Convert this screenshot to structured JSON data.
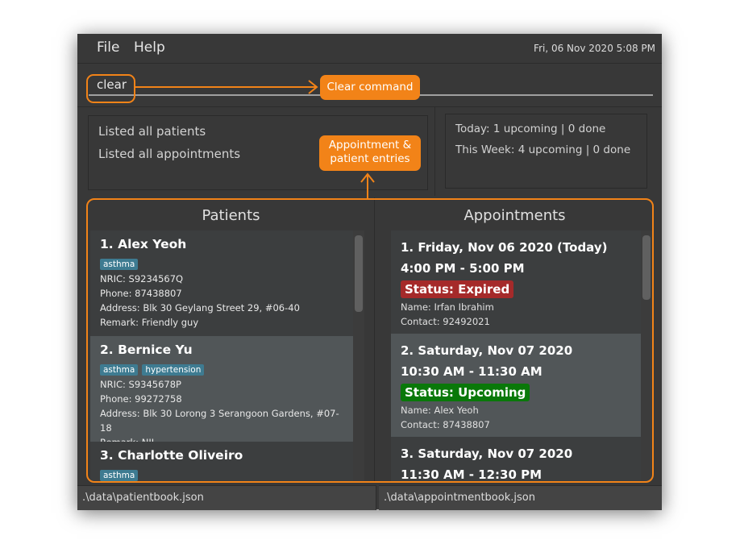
{
  "menu": {
    "items": [
      "File",
      "Help"
    ]
  },
  "clock": "Fri, 06 Nov 2020 5:08 PM",
  "command": {
    "value": "clear",
    "placeholder": ""
  },
  "result_display": {
    "lines": [
      "Listed all patients",
      "Listed all appointments"
    ]
  },
  "stats": {
    "today": "Today: 1 upcoming | 0 done",
    "week": "This Week: 4 upcoming | 0 done"
  },
  "patients_panel": {
    "title": "Patients",
    "items": [
      {
        "title": "1.  Alex Yeoh",
        "tags": [
          "asthma"
        ],
        "nric": "NRIC: S9234567Q",
        "phone": "Phone: 87438807",
        "address": "Address: Blk 30 Geylang Street 29, #06-40",
        "remark": "Remark: Friendly guy"
      },
      {
        "title": "2.  Bernice Yu",
        "tags": [
          "asthma",
          "hypertension"
        ],
        "nric": "NRIC: S9345678P",
        "phone": "Phone: 99272758",
        "address": "Address: Blk 30 Lorong 3 Serangoon Gardens, #07-18",
        "remark": "Remark: NIL"
      },
      {
        "title": "3.  Charlotte Oliveiro",
        "tags": [
          "asthma"
        ]
      }
    ]
  },
  "appointments_panel": {
    "title": "Appointments",
    "items": [
      {
        "date": "1.  Friday, Nov 06 2020 (Today)",
        "time": "4:00 PM - 5:00 PM",
        "status": "Status: Expired",
        "status_color": "#a52a2a",
        "name": "Name: Irfan Ibrahim",
        "contact": "Contact: 92492021"
      },
      {
        "date": "2.  Saturday, Nov 07 2020",
        "time": "10:30 AM - 11:30 AM",
        "status": "Status: Upcoming",
        "status_color": "#097809",
        "name": "Name: Alex Yeoh",
        "contact": "Contact: 87438807"
      },
      {
        "date": "3.  Saturday, Nov 07 2020",
        "time": "11:30 AM - 12:30 PM"
      }
    ]
  },
  "statusbar": {
    "left": ".\\data\\patientbook.json",
    "right": ".\\data\\appointmentbook.json"
  },
  "annotations": {
    "clear_label": "Clear command",
    "entries_label_line1": "Appointment &",
    "entries_label_line2": "patient entries",
    "color": "#f28318"
  }
}
